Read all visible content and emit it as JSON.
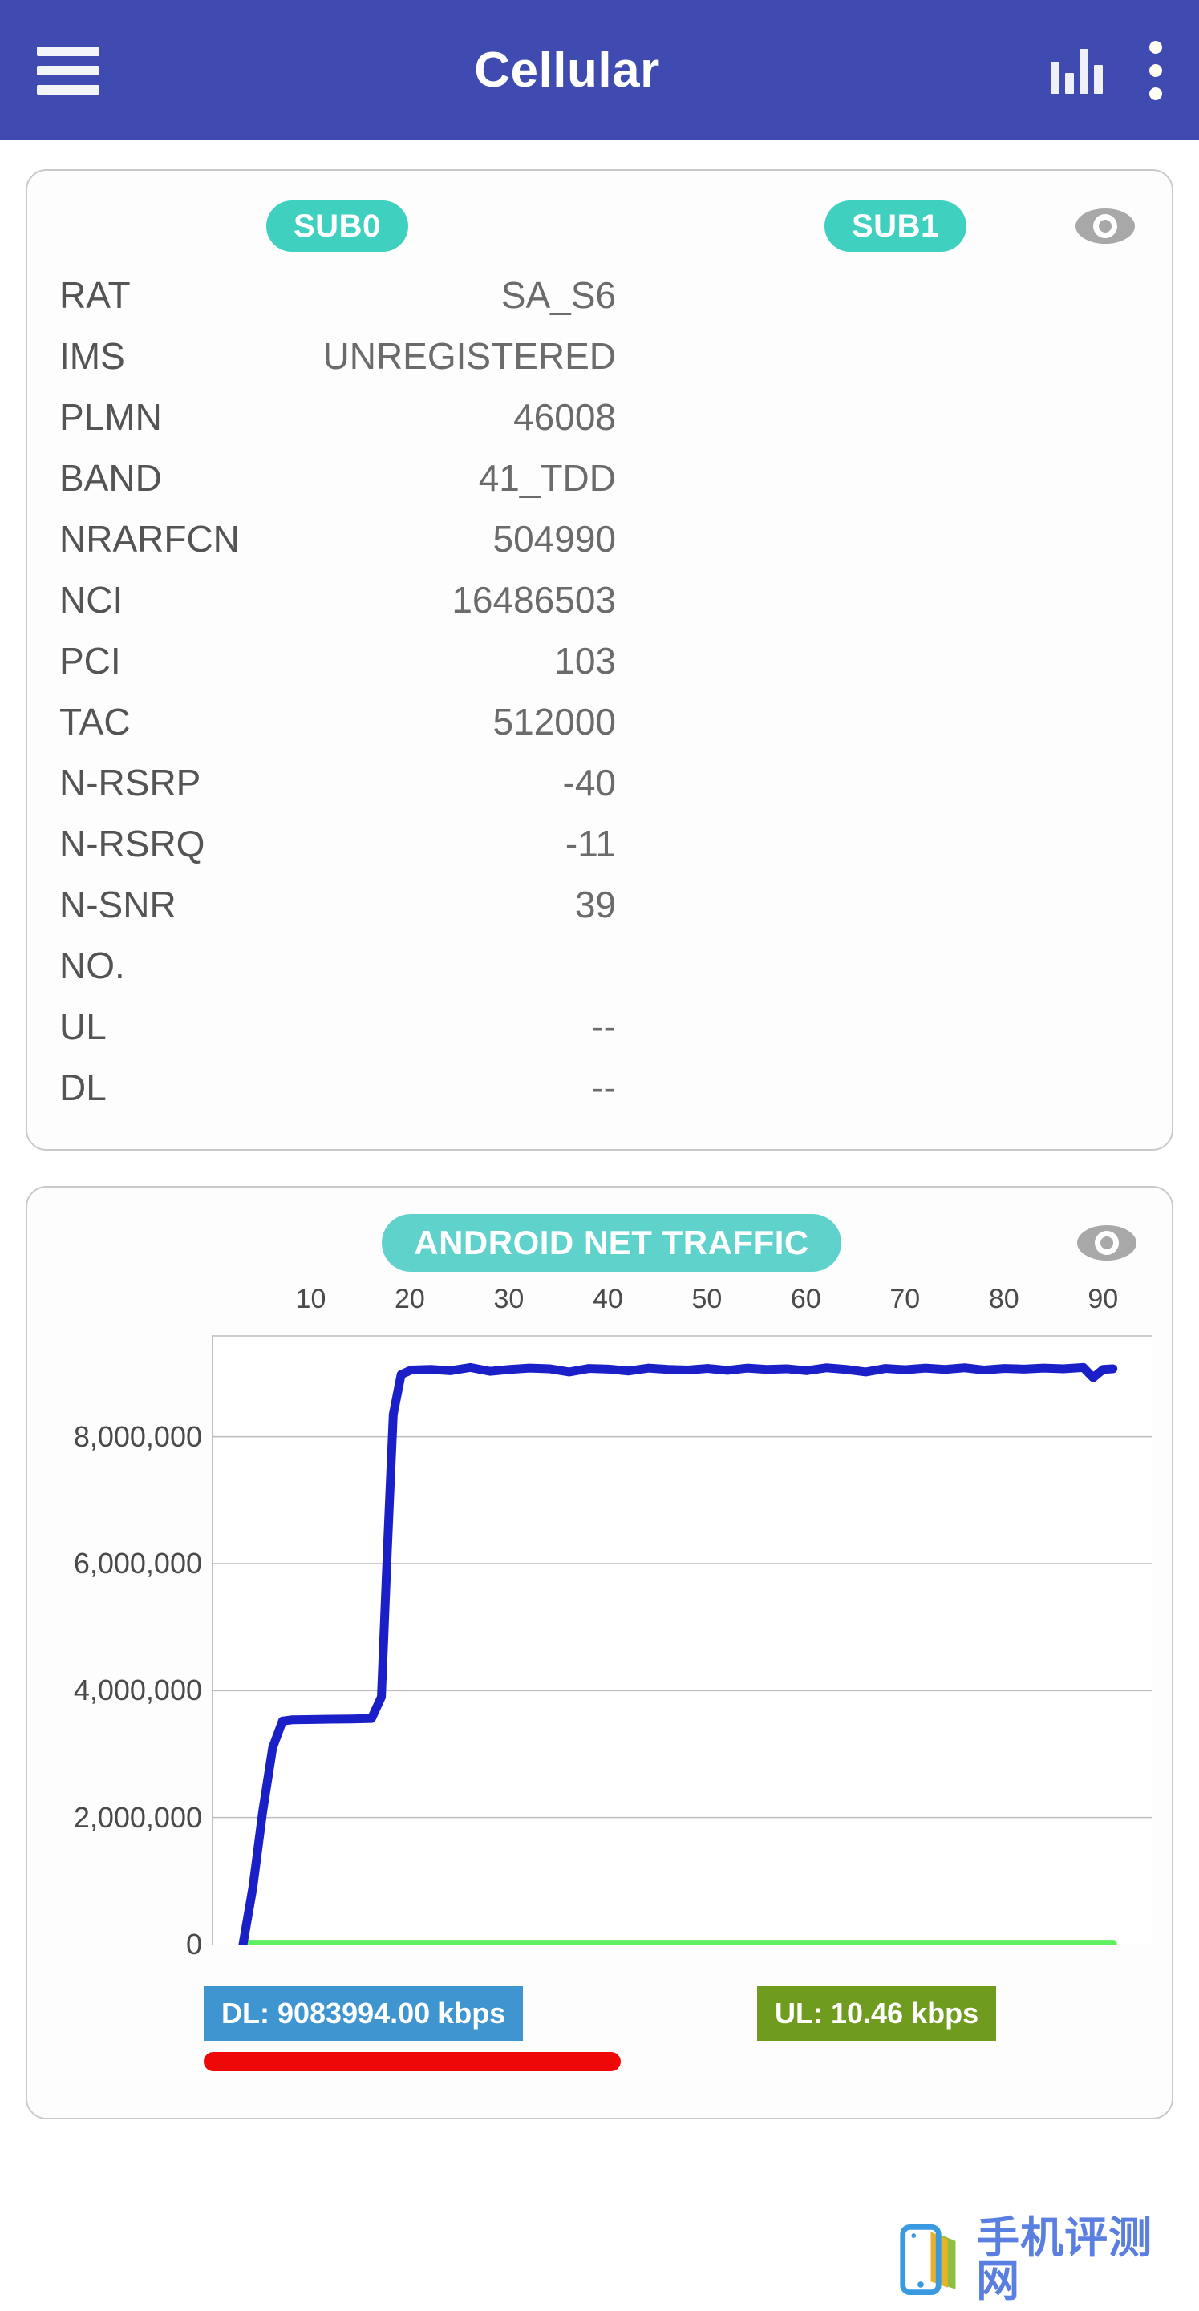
{
  "appbar": {
    "title": "Cellular",
    "menu_icon": "hamburger-icon",
    "chart_icon": "bar-chart-icon",
    "overflow_icon": "kebab-menu-icon"
  },
  "info_card": {
    "sub0_label": "SUB0",
    "sub1_label": "SUB1",
    "eye_icon": "eye-icon",
    "rows": [
      {
        "key": "RAT",
        "value": "SA_S6"
      },
      {
        "key": "IMS",
        "value": "UNREGISTERED"
      },
      {
        "key": "PLMN",
        "value": "46008"
      },
      {
        "key": "BAND",
        "value": "41_TDD"
      },
      {
        "key": "NRARFCN",
        "value": "504990"
      },
      {
        "key": "NCI",
        "value": "16486503"
      },
      {
        "key": "PCI",
        "value": "103"
      },
      {
        "key": "TAC",
        "value": "512000"
      },
      {
        "key": "N-RSRP",
        "value": "-40"
      },
      {
        "key": "N-RSRQ",
        "value": "-11"
      },
      {
        "key": "N-SNR",
        "value": "39"
      },
      {
        "key": "NO.",
        "value": ""
      },
      {
        "key": "UL",
        "value": "--"
      },
      {
        "key": "DL",
        "value": "--"
      }
    ]
  },
  "chart_card": {
    "title": "ANDROID NET TRAFFIC",
    "eye_icon": "eye-icon",
    "dl_badge": "DL: 9083994.00 kbps",
    "ul_badge": "UL: 10.46 kbps"
  },
  "watermark": {
    "text": "手机评测网",
    "icon": "phone-books-logo"
  },
  "colors": {
    "appbar": "#3f4bb0",
    "pill": "#3fd0c0",
    "dl_line": "#1a1fc8",
    "ul_line": "#5ef05e",
    "dl_badge": "#3e95cf",
    "ul_badge": "#6f9c1e",
    "red_bar": "#ef0808"
  },
  "chart_data": {
    "type": "line",
    "title": "ANDROID NET TRAFFIC",
    "xlabel": "",
    "ylabel": "",
    "xlim": [
      0,
      95
    ],
    "ylim": [
      0,
      9600000
    ],
    "grid": true,
    "legend_position": "bottom",
    "xticks": [
      10,
      20,
      30,
      40,
      50,
      60,
      70,
      80,
      90
    ],
    "yticks": [
      0,
      2000000,
      4000000,
      6000000,
      8000000
    ],
    "ytick_labels": [
      "0",
      "2,000,000",
      "4,000,000",
      "6,000,000",
      "8,000,000"
    ],
    "series": [
      {
        "name": "DL",
        "color": "#1a1fc8",
        "x": [
          3,
          4,
          5,
          6,
          7,
          8,
          10,
          12,
          14,
          16,
          17,
          17.6,
          18.2,
          19,
          20,
          22,
          24,
          26,
          28,
          30,
          32,
          34,
          36,
          38,
          40,
          42,
          44,
          46,
          48,
          50,
          52,
          54,
          56,
          58,
          60,
          62,
          64,
          66,
          68,
          70,
          72,
          74,
          76,
          78,
          80,
          82,
          84,
          86,
          88,
          89,
          90,
          91
        ],
        "y": [
          0,
          900000,
          2100000,
          3100000,
          3520000,
          3540000,
          3545000,
          3550000,
          3552000,
          3560000,
          3900000,
          6200000,
          8350000,
          8980000,
          9050000,
          9060000,
          9040000,
          9090000,
          9030000,
          9060000,
          9080000,
          9070000,
          9020000,
          9075000,
          9065000,
          9035000,
          9080000,
          9060000,
          9050000,
          9075000,
          9045000,
          9080000,
          9060000,
          9070000,
          9040000,
          9085000,
          9060000,
          9020000,
          9075000,
          9055000,
          9080000,
          9060000,
          9085000,
          9050000,
          9075000,
          9065000,
          9080000,
          9070000,
          9090000,
          8930000,
          9060000,
          9070000
        ]
      },
      {
        "name": "UL",
        "color": "#5ef05e",
        "x": [
          3,
          91
        ],
        "y": [
          10460,
          10460
        ]
      }
    ]
  }
}
